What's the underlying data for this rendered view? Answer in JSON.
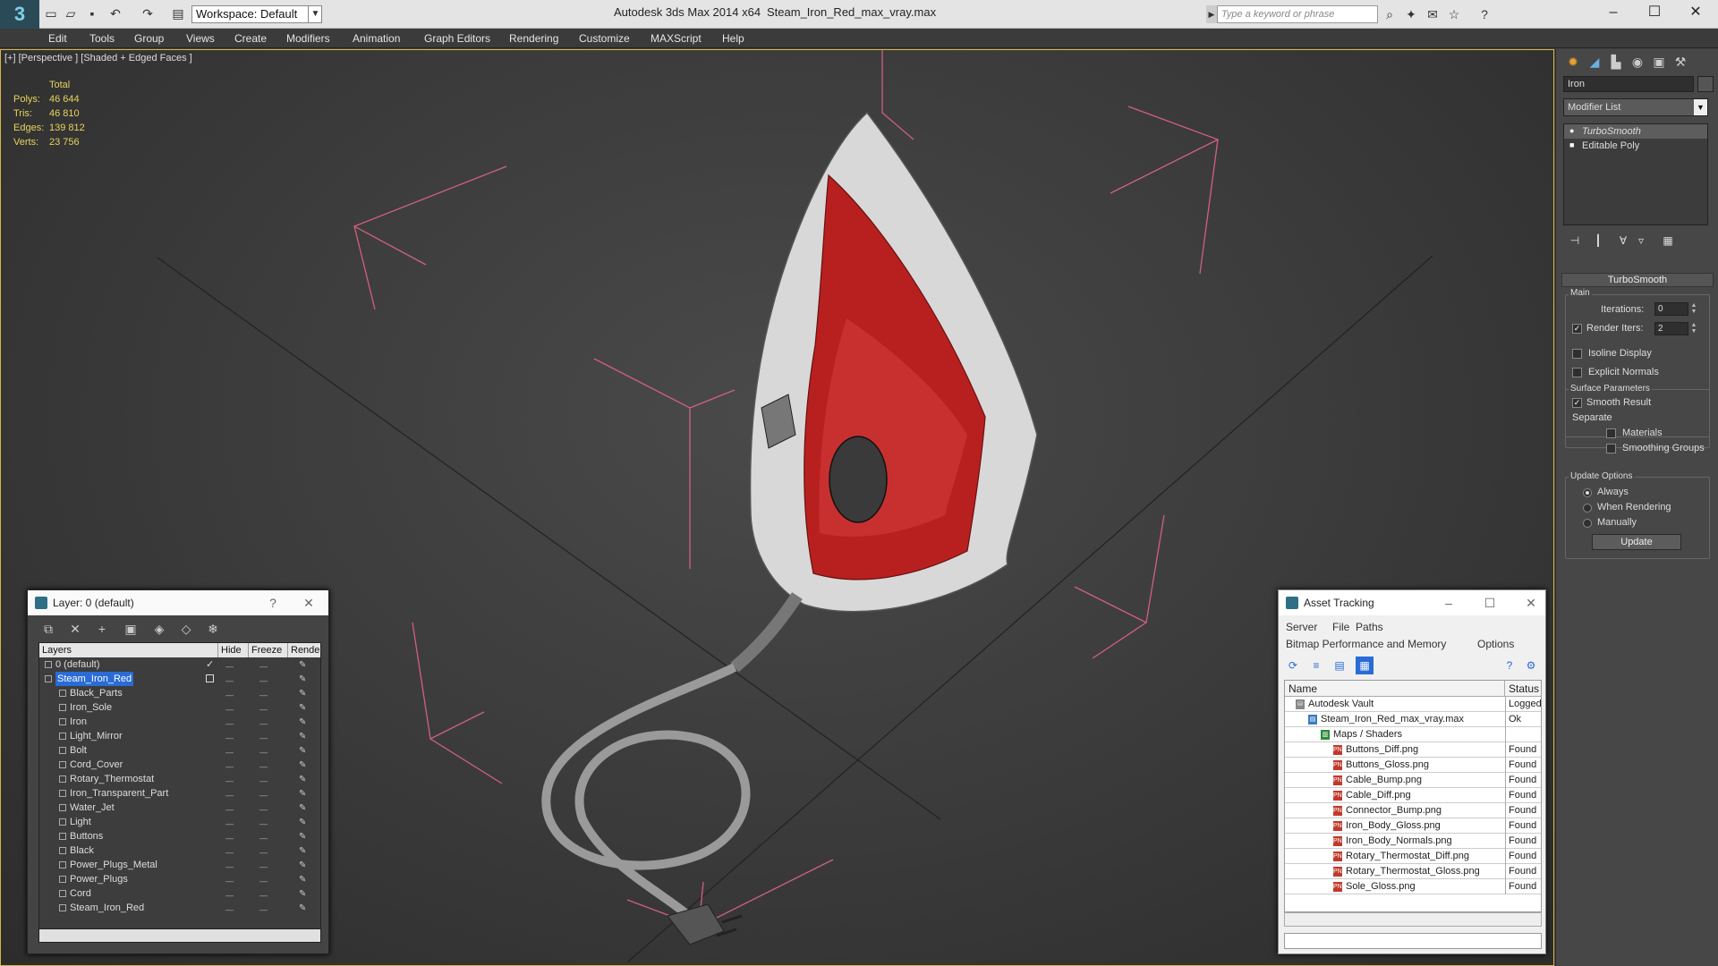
{
  "titlebar": {
    "app_title": "Autodesk 3ds Max  2014 x64",
    "file_title": "Steam_Iron_Red_max_vray.max",
    "workspace_label": "Workspace: Default",
    "search_placeholder": "Type a keyword or phrase",
    "logo": "3"
  },
  "menubar": {
    "items": [
      "Edit",
      "Tools",
      "Group",
      "Views",
      "Create",
      "Modifiers",
      "Animation",
      "Graph Editors",
      "Rendering",
      "Customize",
      "MAXScript",
      "Help"
    ]
  },
  "viewport": {
    "label": "[+] [Perspective ] [Shaded + Edged Faces ]",
    "stats": {
      "header": "Total",
      "rows": [
        {
          "label": "Polys:",
          "value": "46 644"
        },
        {
          "label": "Tris:",
          "value": "46 810"
        },
        {
          "label": "Edges:",
          "value": "139 812"
        },
        {
          "label": "Verts:",
          "value": "23 756"
        }
      ]
    }
  },
  "command_panel": {
    "object_name": "Iron",
    "modifier_list": "Modifier List",
    "stack": [
      {
        "label": "TurboSmooth",
        "selected": true
      },
      {
        "label": "Editable Poly",
        "selected": false
      }
    ],
    "rollout_title": "TurboSmooth",
    "main_group": "Main",
    "iterations_label": "Iterations:",
    "iterations_value": "0",
    "render_iters_label": "Render Iters:",
    "render_iters_value": "2",
    "isoline_label": "Isoline Display",
    "explicit_normals_label": "Explicit Normals",
    "surface_group": "Surface Parameters",
    "smooth_result_label": "Smooth Result",
    "separate_label": "Separate",
    "materials_label": "Materials",
    "smoothing_groups_label": "Smoothing Groups",
    "update_group": "Update Options",
    "always_label": "Always",
    "when_rendering_label": "When Rendering",
    "manually_label": "Manually",
    "update_button": "Update"
  },
  "layer_dialog": {
    "title": "Layer: 0 (default)",
    "columns": [
      "Layers",
      "Hide",
      "Freeze",
      "Render"
    ],
    "rows": [
      {
        "name": "0 (default)",
        "level": 0,
        "checked": true
      },
      {
        "name": "Steam_Iron_Red",
        "level": 0,
        "selected": true
      },
      {
        "name": "Black_Parts",
        "level": 1
      },
      {
        "name": "Iron_Sole",
        "level": 1
      },
      {
        "name": "Iron",
        "level": 1
      },
      {
        "name": "Light_Mirror",
        "level": 1
      },
      {
        "name": "Bolt",
        "level": 1
      },
      {
        "name": "Cord_Cover",
        "level": 1
      },
      {
        "name": "Rotary_Thermostat",
        "level": 1
      },
      {
        "name": "Iron_Transparent_Part",
        "level": 1
      },
      {
        "name": "Water_Jet",
        "level": 1
      },
      {
        "name": "Light",
        "level": 1
      },
      {
        "name": "Buttons",
        "level": 1
      },
      {
        "name": "Black",
        "level": 1
      },
      {
        "name": "Power_Plugs_Metal",
        "level": 1
      },
      {
        "name": "Power_Plugs",
        "level": 1
      },
      {
        "name": "Cord",
        "level": 1
      },
      {
        "name": "Steam_Iron_Red",
        "level": 1
      }
    ]
  },
  "asset_dialog": {
    "title": "Asset Tracking",
    "menu1": [
      "Server",
      "File",
      "Paths"
    ],
    "menu2": [
      "Bitmap Performance and Memory",
      "Options"
    ],
    "columns": [
      "Name",
      "Status"
    ],
    "rows": [
      {
        "name": "Autodesk Vault",
        "status": "Logged",
        "level": 0,
        "icon": "vault"
      },
      {
        "name": "Steam_Iron_Red_max_vray.max",
        "status": "Ok",
        "level": 1,
        "icon": "file"
      },
      {
        "name": "Maps / Shaders",
        "status": "",
        "level": 2,
        "icon": "folder"
      },
      {
        "name": "Buttons_Diff.png",
        "status": "Found",
        "level": 3,
        "icon": "png"
      },
      {
        "name": "Buttons_Gloss.png",
        "status": "Found",
        "level": 3,
        "icon": "png"
      },
      {
        "name": "Cable_Bump.png",
        "status": "Found",
        "level": 3,
        "icon": "png"
      },
      {
        "name": "Cable_Diff.png",
        "status": "Found",
        "level": 3,
        "icon": "png"
      },
      {
        "name": "Connector_Bump.png",
        "status": "Found",
        "level": 3,
        "icon": "png"
      },
      {
        "name": "Iron_Body_Gloss.png",
        "status": "Found",
        "level": 3,
        "icon": "png"
      },
      {
        "name": "Iron_Body_Normals.png",
        "status": "Found",
        "level": 3,
        "icon": "png"
      },
      {
        "name": "Rotary_Thermostat_Diff.png",
        "status": "Found",
        "level": 3,
        "icon": "png"
      },
      {
        "name": "Rotary_Thermostat_Gloss.png",
        "status": "Found",
        "level": 3,
        "icon": "png"
      },
      {
        "name": "Sole_Gloss.png",
        "status": "Found",
        "level": 3,
        "icon": "png"
      }
    ]
  }
}
